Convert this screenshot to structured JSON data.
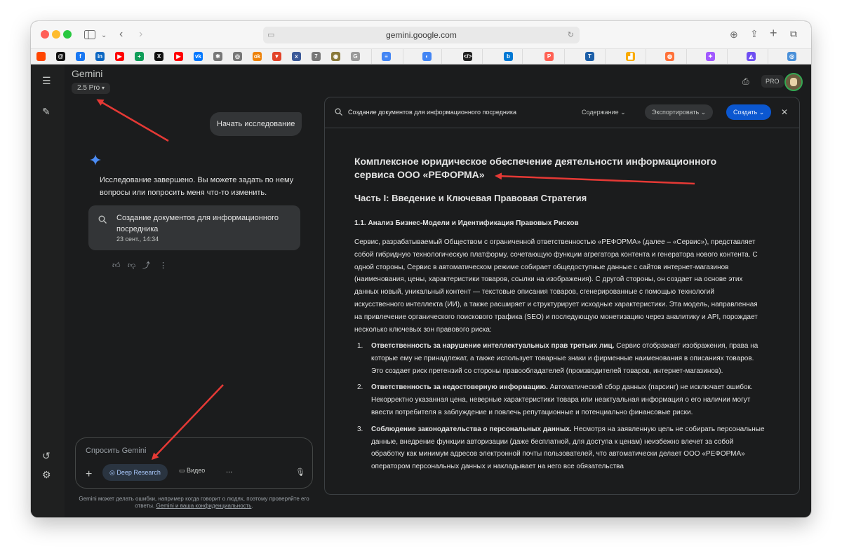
{
  "browser": {
    "url": "gemini.google.com",
    "favicons": [
      {
        "name": "reddit-icon",
        "color": "#ff4500",
        "glyph": ""
      },
      {
        "name": "threads-icon",
        "color": "#111111",
        "glyph": "@"
      },
      {
        "name": "facebook-icon",
        "color": "#1877f2",
        "glyph": "f"
      },
      {
        "name": "linkedin-icon",
        "color": "#0a66c2",
        "glyph": "in"
      },
      {
        "name": "youtube-icon",
        "color": "#ff0000",
        "glyph": "▶"
      },
      {
        "name": "sheets-icon",
        "color": "#0f9d58",
        "glyph": "+"
      },
      {
        "name": "x-icon",
        "color": "#111111",
        "glyph": "X"
      },
      {
        "name": "youtube-icon",
        "color": "#ff0000",
        "glyph": "▶"
      },
      {
        "name": "vk-icon",
        "color": "#0077ff",
        "glyph": "vk"
      },
      {
        "name": "globe-icon",
        "color": "#777777",
        "glyph": "✱"
      },
      {
        "name": "compass-icon",
        "color": "#777777",
        "glyph": "◎"
      },
      {
        "name": "odnoklassniki-icon",
        "color": "#ee8208",
        "glyph": "ok"
      },
      {
        "name": "gitlab-icon",
        "color": "#e24329",
        "glyph": "▼"
      },
      {
        "name": "x-mark-icon",
        "color": "#3b5998",
        "glyph": "x"
      },
      {
        "name": "seven-icon",
        "color": "#777777",
        "glyph": "7"
      },
      {
        "name": "extension-icon",
        "color": "#8a7a3a",
        "glyph": "◉"
      },
      {
        "name": "grammarly-icon",
        "color": "#9a9a9a",
        "glyph": "G"
      },
      {
        "name": "docs-icon",
        "color": "#4285f4",
        "glyph": "≡"
      },
      {
        "name": "chrome-icon",
        "color": "#4285f4",
        "glyph": "◐"
      },
      {
        "name": "code-icon",
        "color": "#222222",
        "glyph": "</>"
      },
      {
        "name": "bing-icon",
        "color": "#0078d4",
        "glyph": "b"
      },
      {
        "name": "producthunt-icon",
        "color": "#ff6154",
        "glyph": "P"
      },
      {
        "name": "typography-icon",
        "color": "#1c5fa8",
        "glyph": "T"
      },
      {
        "name": "analytics-icon",
        "color": "#f9ab00",
        "glyph": "▟"
      },
      {
        "name": "firefox-icon",
        "color": "#ff7139",
        "glyph": "◍"
      },
      {
        "name": "figma-icon",
        "color": "#a259ff",
        "glyph": "✦"
      },
      {
        "name": "arc-icon",
        "color": "#6e4ef2",
        "glyph": "◭"
      },
      {
        "name": "web-icon",
        "color": "#4a90d9",
        "glyph": "◎"
      }
    ]
  },
  "app": {
    "name": "Gemini",
    "model": "2.5 Pro",
    "pro_badge": "PRO"
  },
  "chat": {
    "user_message": "Начать исследование",
    "response": "Исследование завершено. Вы можете задать по нему вопросы или попросить меня что-то изменить.",
    "card_title": "Создание документов для информационного посредника",
    "card_date": "23 сент., 14:34"
  },
  "input": {
    "placeholder": "Спросить Gemini",
    "deep_research": "Deep Research",
    "video": "Видео",
    "more": "...",
    "disclaimer_pre": "Gemini может делать ошибки, например когда говорит о людях, поэтому проверяйте его ответы.",
    "disclaimer_link": "Gemini и ваша конфиденциальность",
    "disclaimer_post": "."
  },
  "panel": {
    "title": "Создание документов для информационного посредника",
    "contents": "Содержание",
    "export": "Экспортировать",
    "create": "Создать"
  },
  "doc": {
    "h1": "Комплексное юридическое обеспечение деятельности информационного сервиса ООО «РЕФОРМА»",
    "h2": "Часть I: Введение и Ключевая Правовая Стратегия",
    "h3": "1.1. Анализ Бизнес-Модели и Идентификация Правовых Рисков",
    "para": "Сервис, разрабатываемый Обществом с ограниченной ответственностью «РЕФОРМА» (далее – «Сервис»), представляет собой гибридную технологическую платформу, сочетающую функции агрегатора контента и генератора нового контента. С одной стороны, Сервис в автоматическом режиме собирает общедоступные данные с сайтов интернет-магазинов (наименования, цены, характеристики товаров, ссылки на изображения). С другой стороны, он создает на основе этих данных новый, уникальный контент — текстовые описания товаров, сгенерированные с помощью технологий искусственного интеллекта (ИИ), а также расширяет и структурирует исходные характеристики. Эта модель, направленная на привлечение органического поискового трафика (SEO) и последующую монетизацию через аналитику и API, порождает несколько ключевых зон правового риска:",
    "items": [
      {
        "num": "1.",
        "bold": "Ответственность за нарушение интеллектуальных прав третьих лиц.",
        "text": " Сервис отображает изображения, права на которые ему не принадлежат, а также использует товарные знаки и фирменные наименования в описаниях товаров. Это создает риск претензий со стороны правообладателей (производителей товаров, интернет-магазинов)."
      },
      {
        "num": "2.",
        "bold": "Ответственность за недостоверную информацию.",
        "text": " Автоматический сбор данных (парсинг) не исключает ошибок. Некорректно указанная цена, неверные характеристики товара или неактуальная информация о его наличии могут ввести потребителя в заблуждение и повлечь репутационные и потенциально финансовые риски."
      },
      {
        "num": "3.",
        "bold": "Соблюдение законодательства о персональных данных.",
        "text": " Несмотря на заявленную цель не собирать персональные данные, внедрение функции авторизации (даже бесплатной, для доступа к ценам) неизбежно влечет за собой обработку как минимум адресов электронной почты пользователей, что автоматически делает ООО «РЕФОРМА» оператором персональных данных и накладывает на него все обязательства"
      }
    ]
  }
}
